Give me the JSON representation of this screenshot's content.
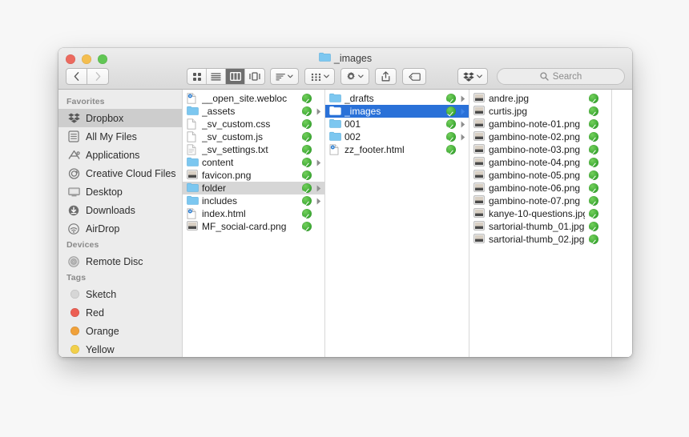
{
  "window": {
    "title": "_images",
    "title_icon": "folder-icon",
    "traffic_lights": [
      "close-red",
      "minimize-yellow",
      "maximize-green"
    ]
  },
  "toolbar": {
    "back_label": "‹",
    "forward_label": "›",
    "view_modes": [
      {
        "name": "icon-view",
        "label": "icon",
        "active": false
      },
      {
        "name": "list-view",
        "label": "list",
        "active": false
      },
      {
        "name": "column-view",
        "label": "column",
        "active": true
      },
      {
        "name": "gallery-view",
        "label": "gallery",
        "active": false
      }
    ],
    "arrange_label": "",
    "group_label": "",
    "action_label": "",
    "share_label": "",
    "tag_label": "",
    "dropbox_label": ""
  },
  "search": {
    "placeholder": "Search",
    "value": "",
    "icon": "search-icon"
  },
  "sidebar": {
    "sections": [
      {
        "header": "Favorites",
        "items": [
          {
            "label": "Dropbox",
            "icon": "dropbox-icon",
            "selected": true
          },
          {
            "label": "All My Files",
            "icon": "all-my-files-icon",
            "selected": false
          },
          {
            "label": "Applications",
            "icon": "applications-icon",
            "selected": false
          },
          {
            "label": "Creative Cloud Files",
            "icon": "creative-cloud-icon",
            "selected": false
          },
          {
            "label": "Desktop",
            "icon": "desktop-icon",
            "selected": false
          },
          {
            "label": "Downloads",
            "icon": "downloads-icon",
            "selected": false
          },
          {
            "label": "AirDrop",
            "icon": "airdrop-icon",
            "selected": false
          }
        ]
      },
      {
        "header": "Devices",
        "items": [
          {
            "label": "Remote Disc",
            "icon": "disc-icon",
            "selected": false
          }
        ]
      },
      {
        "header": "Tags",
        "items": [
          {
            "label": "Sketch",
            "icon": "tag-dot",
            "color": "#d6d6d6",
            "selected": false
          },
          {
            "label": "Red",
            "icon": "tag-dot",
            "color": "#ec5f53",
            "selected": false
          },
          {
            "label": "Orange",
            "icon": "tag-dot",
            "color": "#f0a13a",
            "selected": false
          },
          {
            "label": "Yellow",
            "icon": "tag-dot",
            "color": "#f2d04b",
            "selected": false
          }
        ]
      }
    ]
  },
  "columns": [
    {
      "name": "column-1",
      "items": [
        {
          "label": "__open_site.webloc",
          "icon": "webloc-icon",
          "synced": true,
          "has_children": false,
          "selected": false
        },
        {
          "label": "_assets",
          "icon": "folder-icon",
          "synced": true,
          "has_children": true,
          "selected": false
        },
        {
          "label": "_sv_custom.css",
          "icon": "document-icon",
          "synced": true,
          "has_children": false,
          "selected": false
        },
        {
          "label": "_sv_custom.js",
          "icon": "document-icon",
          "synced": true,
          "has_children": false,
          "selected": false
        },
        {
          "label": "_sv_settings.txt",
          "icon": "text-document-icon",
          "synced": true,
          "has_children": false,
          "selected": false
        },
        {
          "label": "content",
          "icon": "folder-icon",
          "synced": true,
          "has_children": true,
          "selected": false
        },
        {
          "label": "favicon.png",
          "icon": "image-icon",
          "synced": true,
          "has_children": false,
          "selected": false
        },
        {
          "label": "folder",
          "icon": "folder-icon",
          "synced": true,
          "has_children": true,
          "selected": "gray"
        },
        {
          "label": "includes",
          "icon": "folder-icon",
          "synced": true,
          "has_children": true,
          "selected": false
        },
        {
          "label": "index.html",
          "icon": "webloc-icon",
          "synced": true,
          "has_children": false,
          "selected": false
        },
        {
          "label": "MF_social-card.png",
          "icon": "image-icon",
          "synced": true,
          "has_children": false,
          "selected": false
        }
      ]
    },
    {
      "name": "column-2",
      "items": [
        {
          "label": "_drafts",
          "icon": "folder-icon",
          "synced": true,
          "has_children": true,
          "selected": false
        },
        {
          "label": "_images",
          "icon": "folder-icon",
          "synced": true,
          "has_children": true,
          "selected": "blue"
        },
        {
          "label": "001",
          "icon": "folder-icon",
          "synced": true,
          "has_children": true,
          "selected": false
        },
        {
          "label": "002",
          "icon": "folder-icon",
          "synced": true,
          "has_children": true,
          "selected": false
        },
        {
          "label": "zz_footer.html",
          "icon": "webloc-icon",
          "synced": true,
          "has_children": false,
          "selected": false
        }
      ]
    },
    {
      "name": "column-3",
      "items": [
        {
          "label": "andre.jpg",
          "icon": "image-icon",
          "synced": true,
          "has_children": false,
          "selected": false
        },
        {
          "label": "curtis.jpg",
          "icon": "image-icon",
          "synced": true,
          "has_children": false,
          "selected": false
        },
        {
          "label": "gambino-note-01.png",
          "icon": "image-icon",
          "synced": true,
          "has_children": false,
          "selected": false
        },
        {
          "label": "gambino-note-02.png",
          "icon": "image-icon",
          "synced": true,
          "has_children": false,
          "selected": false
        },
        {
          "label": "gambino-note-03.png",
          "icon": "image-icon",
          "synced": true,
          "has_children": false,
          "selected": false
        },
        {
          "label": "gambino-note-04.png",
          "icon": "image-icon",
          "synced": true,
          "has_children": false,
          "selected": false
        },
        {
          "label": "gambino-note-05.png",
          "icon": "image-icon",
          "synced": true,
          "has_children": false,
          "selected": false
        },
        {
          "label": "gambino-note-06.png",
          "icon": "image-icon",
          "synced": true,
          "has_children": false,
          "selected": false
        },
        {
          "label": "gambino-note-07.png",
          "icon": "image-icon",
          "synced": true,
          "has_children": false,
          "selected": false
        },
        {
          "label": "kanye-10-questions.jpg",
          "icon": "image-icon",
          "synced": true,
          "has_children": false,
          "selected": false
        },
        {
          "label": "sartorial-thumb_01.jpg",
          "icon": "image-icon",
          "synced": true,
          "has_children": false,
          "selected": false
        },
        {
          "label": "sartorial-thumb_02.jpg",
          "icon": "image-icon",
          "synced": true,
          "has_children": false,
          "selected": false
        }
      ]
    },
    {
      "name": "column-4",
      "items": []
    }
  ],
  "colors": {
    "selection_blue": "#2a71d8",
    "selection_gray": "#d6d6d6",
    "sync_green": "#3aa831",
    "folder_blue": "#6fc2ee",
    "sidebar_bg": "#ececec"
  }
}
